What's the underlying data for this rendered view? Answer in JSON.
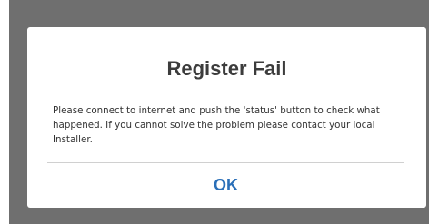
{
  "dialog": {
    "title": "Register Fail",
    "message": "Please connect to internet and push the 'status' button to check what happened. If you cannot solve the problem please contact your local Installer.",
    "ok_label": "OK"
  },
  "colors": {
    "overlay": "#6f6f6f",
    "dialog_background": "#ffffff",
    "title_text": "#3c3c3c",
    "message_text": "#333333",
    "ok_text": "#2a6fb8",
    "divider": "#d0d0d0"
  }
}
